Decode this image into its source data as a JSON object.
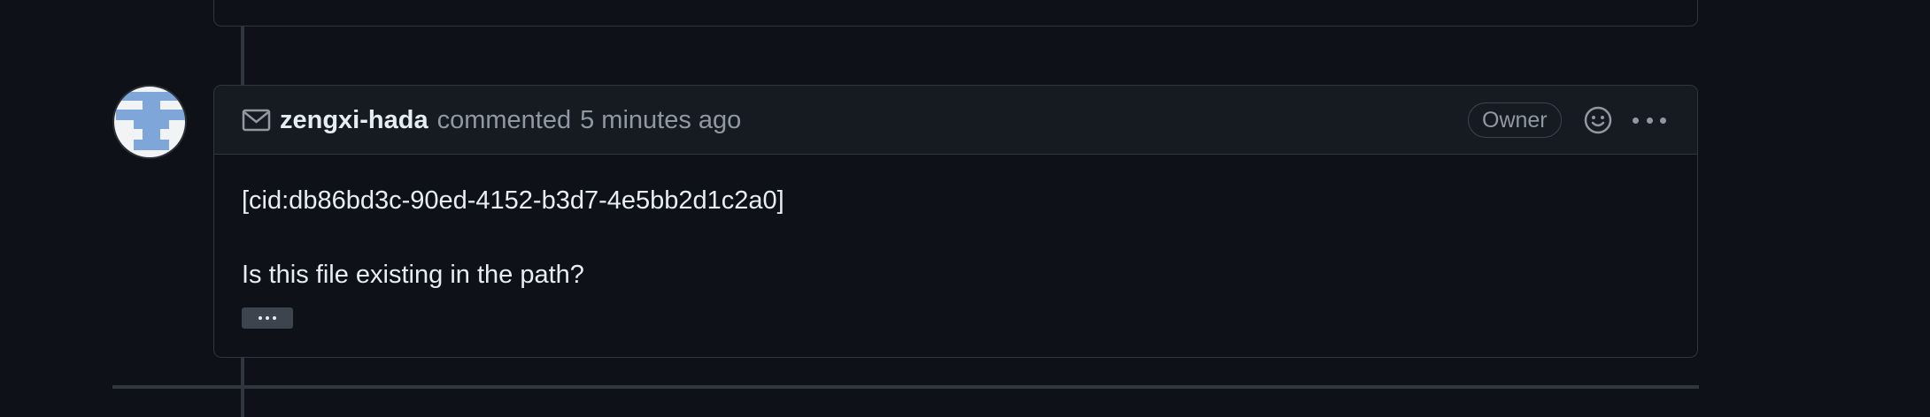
{
  "comment": {
    "author": "zengxi-hada",
    "action": "commented",
    "time": "5 minutes ago",
    "badge": "Owner",
    "body_lines": [
      "[cid:db86bd3c-90ed-4152-b3d7-4e5bb2d1c2a0]",
      "Is this file existing in the path?"
    ]
  },
  "icons": {
    "mail": "mail-icon",
    "emoji": "smiley-icon",
    "more": "kebab-horizontal-icon",
    "expand": "ellipsis-icon"
  },
  "colors": {
    "background": "#0e1117",
    "header_bg": "#161b22",
    "border": "#30363d",
    "text": "#e6edf3",
    "muted": "#9198a1",
    "avatar_blue": "#7ea6d8"
  }
}
